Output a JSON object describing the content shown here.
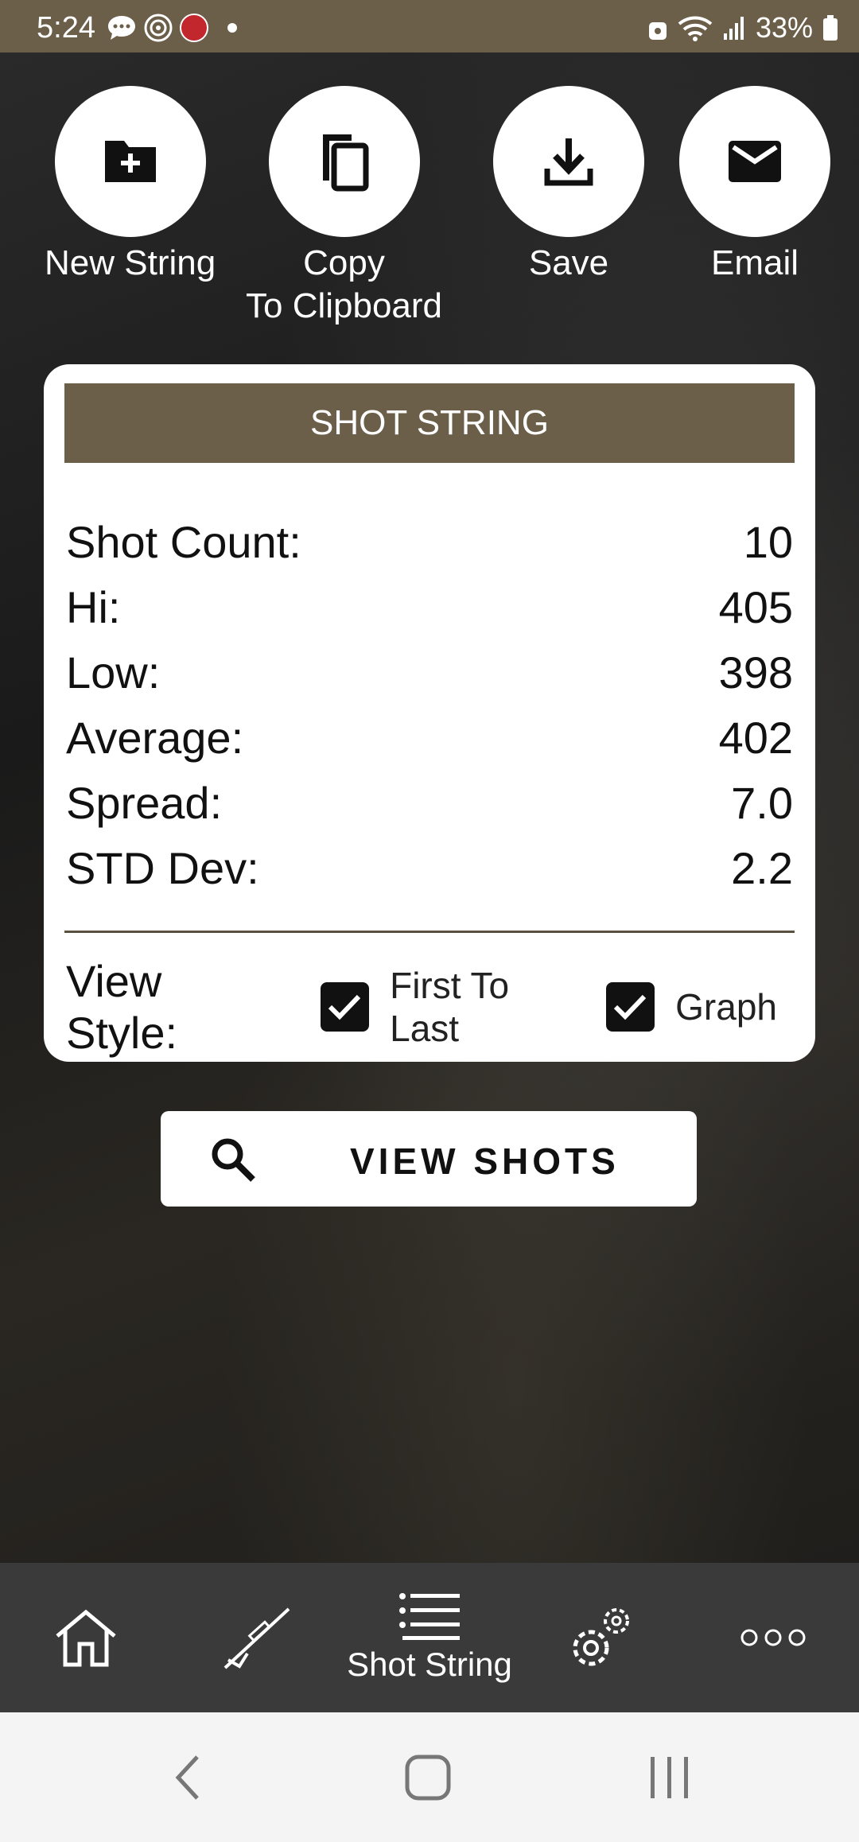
{
  "status_bar": {
    "time": "5:24",
    "battery": "33%",
    "icons": [
      "chat-icon",
      "at-icon",
      "app-badge-icon",
      "notification-dot",
      "lock-icon",
      "wifi-icon",
      "signal-icon",
      "battery-icon"
    ]
  },
  "actions": [
    {
      "label": "New String",
      "icon": "new-folder-icon"
    },
    {
      "label": "Copy\nTo Clipboard",
      "icon": "copy-icon"
    },
    {
      "label": "Save",
      "icon": "download-icon"
    },
    {
      "label": "Email",
      "icon": "email-icon"
    }
  ],
  "card": {
    "title": "SHOT STRING",
    "stats": [
      {
        "label": "Shot Count:",
        "value": "10"
      },
      {
        "label": "Hi:",
        "value": "405"
      },
      {
        "label": "Low:",
        "value": "398"
      },
      {
        "label": "Average:",
        "value": "402"
      },
      {
        "label": "Spread:",
        "value": "7.0"
      },
      {
        "label": "STD Dev:",
        "value": "2.2"
      }
    ],
    "view_style_label": "View Style:",
    "options": [
      {
        "label": "First To Last",
        "checked": true
      },
      {
        "label": "Graph",
        "checked": true
      }
    ]
  },
  "view_shots_label": "VIEW SHOTS",
  "bottom_nav": {
    "items": [
      {
        "icon": "home-icon",
        "label": ""
      },
      {
        "icon": "rifle-icon",
        "label": ""
      },
      {
        "icon": "list-icon",
        "label": "Shot String"
      },
      {
        "icon": "gear-icon",
        "label": ""
      },
      {
        "icon": "more-icon",
        "label": ""
      }
    ]
  },
  "colors": {
    "accent": "#6b5f49",
    "nav_bg": "#3a3a3a"
  }
}
